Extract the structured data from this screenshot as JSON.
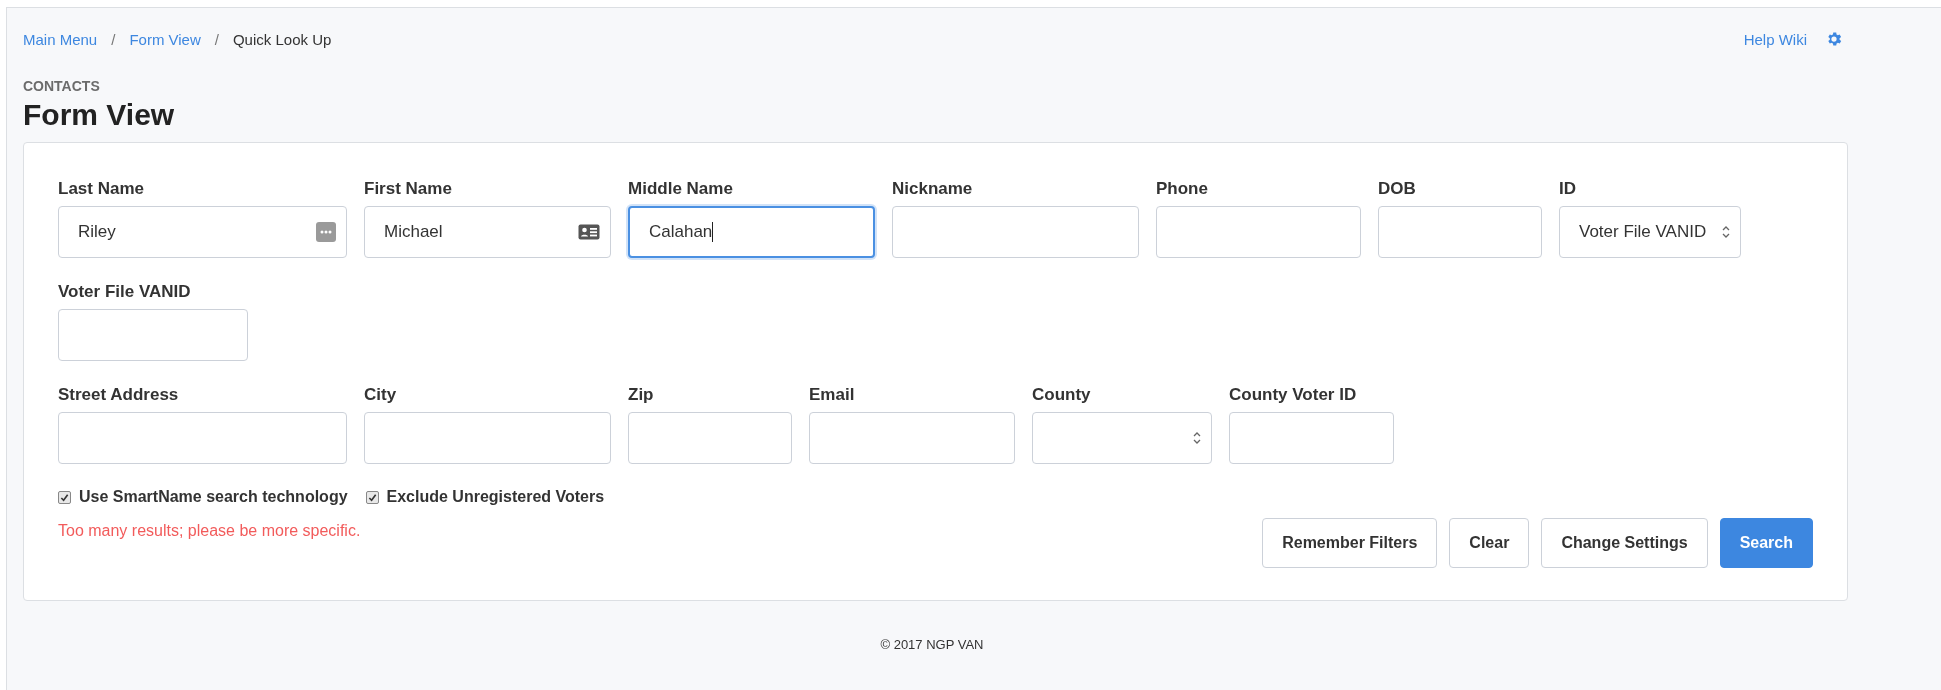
{
  "breadcrumb": [
    {
      "label": "Main Menu",
      "kind": "link"
    },
    {
      "label": "/",
      "kind": "separator"
    },
    {
      "label": "Form View",
      "kind": "link"
    },
    {
      "label": "/",
      "kind": "separator"
    },
    {
      "label": "Quick Look Up",
      "kind": "current"
    }
  ],
  "help_link": "Help Wiki",
  "section": "CONTACTS",
  "title": "Form View",
  "form": {
    "rows": [
      {
        "fields": [
          {
            "label": "Last Name",
            "kind": "text",
            "value": "Riley",
            "focused": false
          },
          {
            "label": "First Name",
            "kind": "text",
            "value": "Michael",
            "focused": false
          },
          {
            "label": "Middle Name",
            "kind": "text",
            "value": "Calahan",
            "focused": true
          },
          {
            "label": "Nickname",
            "kind": "text",
            "focused": false
          },
          {
            "label": "Phone",
            "kind": "text",
            "focused": false
          },
          {
            "label": "DOB",
            "kind": "text",
            "focused": false
          },
          {
            "label": "ID",
            "kind": "select",
            "value": "Voter File VANID",
            "focused": false
          }
        ]
      },
      {
        "fields": [
          {
            "label": "Voter File VANID",
            "kind": "text",
            "focused": false
          }
        ]
      },
      {
        "fields": [
          {
            "label": "Street Address",
            "kind": "text",
            "focused": false
          },
          {
            "label": "City",
            "kind": "text",
            "focused": false
          },
          {
            "label": "Zip",
            "kind": "text",
            "focused": false
          },
          {
            "label": "Email",
            "kind": "text",
            "focused": false
          },
          {
            "label": "County",
            "kind": "select",
            "focused": false
          },
          {
            "label": "County Voter ID",
            "kind": "text",
            "focused": false
          }
        ]
      }
    ],
    "checkboxes": [
      {
        "label": "Use SmartName search technology",
        "checked": true
      },
      {
        "label": "Exclude Unregistered Voters",
        "checked": true
      }
    ],
    "error": "Too many results; please be more specific.",
    "buttons": [
      {
        "label": "Remember Filters",
        "kind": "default"
      },
      {
        "label": "Clear",
        "kind": "default"
      },
      {
        "label": "Change Settings",
        "kind": "default"
      },
      {
        "label": "Search",
        "kind": "primary"
      }
    ]
  },
  "footer": "© 2017 NGP VAN"
}
